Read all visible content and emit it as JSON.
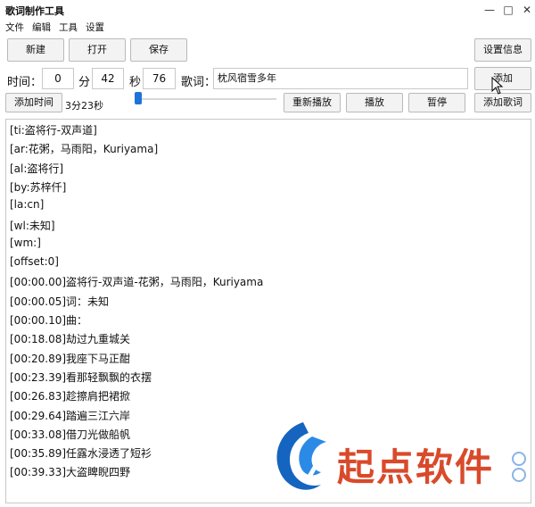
{
  "window": {
    "title": "歌词制作工具"
  },
  "menu": {
    "items": [
      "文件",
      "编辑",
      "工具",
      "设置"
    ]
  },
  "toolbar": {
    "new_label": "新建",
    "open_label": "打开",
    "save_label": "保存",
    "settings_label": "设置信息"
  },
  "time_row": {
    "time_label": "时间：",
    "hours": "0",
    "min_label": "分",
    "minutes": "42",
    "sec_label": "秒",
    "seconds": "76",
    "lyric_label": "歌词：",
    "lyric_value": "枕风宿雪多年",
    "add_label": "添加"
  },
  "controls": {
    "add_time_label": "添加时间",
    "duration": "3分23秒",
    "progress": 0.02,
    "replay_label": "重新播放",
    "play_label": "播放",
    "pause_label": "暂停",
    "add_lyric_label": "添加歌词"
  },
  "lyrics": [
    "[ti:盗将行-双声道]",
    "[ar:花粥，马雨阳，Kuriyama]",
    "[al:盗将行]",
    "[by:苏梓仟]",
    "[la:cn]",
    "[wl:未知]",
    "[wm:]",
    "[offset:0]",
    "[00:00.00]盗将行-双声道-花粥，马雨阳，Kuriyama",
    "[00:00.05]词：未知",
    "[00:00.10]曲：",
    "[00:18.08]劫过九重城关",
    "[00:20.89]我座下马正酣",
    "[00:23.39]看那轻飘飘的衣摆",
    "[00:26.83]趁擦肩把裙掀",
    "[00:29.64]踏遍三江六岸",
    "[00:33.08]借刀光做船帆",
    "[00:35.89]任露水浸透了短衫",
    "[00:39.33]大盗睥睨四野"
  ],
  "watermark": {
    "text": "起点软件"
  },
  "icons": {
    "cursor": "mouse-pointer-icon",
    "logo": "qidian-logo-icon"
  },
  "colors": {
    "accent": "#1e73d8",
    "watermark": "#d94a2a"
  }
}
